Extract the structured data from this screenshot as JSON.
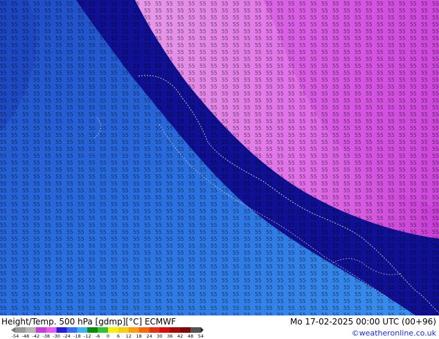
{
  "footer": {
    "title": "Height/Temp. 500 hPa [gdmp][°C] ECMWF",
    "valid_time": "Mo 17-02-2025 00:00 UTC (00+96)",
    "credit": "©weatheronline.co.uk"
  },
  "colorscale": {
    "labels": [
      "-54",
      "-48",
      "-42",
      "-38",
      "-30",
      "-24",
      "-18",
      "-12",
      "-6",
      "0",
      "6",
      "12",
      "18",
      "24",
      "30",
      "36",
      "42",
      "48",
      "54"
    ],
    "colors": [
      "#9a9a9a",
      "#b6b6b6",
      "#c43fd8",
      "#e55cf3",
      "#2a1fcf",
      "#3a6bf0",
      "#3fb2f0",
      "#0a8a0a",
      "#33c233",
      "#f2f20f",
      "#f7ce11",
      "#f7a014",
      "#f06a14",
      "#e13214",
      "#d10f0f",
      "#a00b0b",
      "#7c0707",
      "#555555"
    ]
  },
  "map": {
    "region_colors": {
      "west_blue": "#2c7fe6",
      "mid_blue": "#1f4fc9",
      "dark_band": "#0d0d8c",
      "light_purple": "#e58ee8",
      "magenta": "#d04fe0"
    }
  }
}
